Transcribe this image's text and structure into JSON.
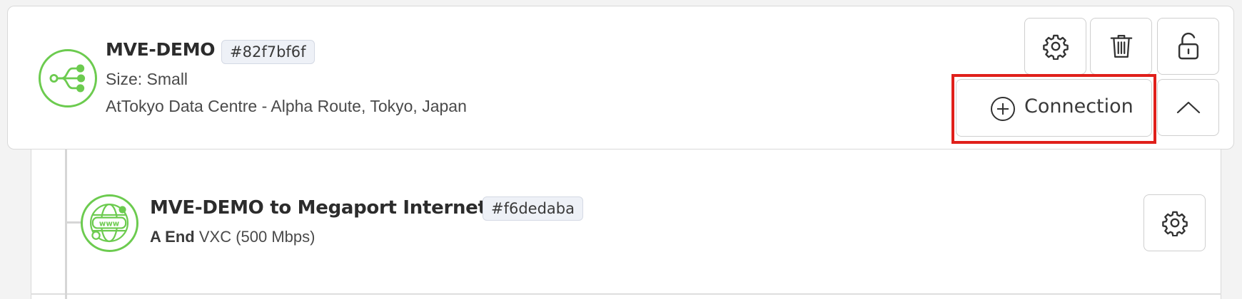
{
  "mve": {
    "name": "MVE-DEMO",
    "id_badge": "#82f7bf6f",
    "size_text": "Size: Small",
    "location_text": "AtTokyo Data Centre - Alpha Route, Tokyo, Japan",
    "icon": "mve-branch-icon",
    "accent_color": "#6ccb4f"
  },
  "actions": {
    "settings_icon": "gear-icon",
    "delete_icon": "trash-icon",
    "lock_icon": "unlocked-padlock-icon",
    "add_connection_label": "Connection",
    "add_connection_icon": "plus-circle-icon",
    "collapse_icon": "chevron-up-icon",
    "highlight_color": "#e0201b"
  },
  "connections": [
    {
      "name": "MVE-DEMO to Megaport Internet",
      "id_badge": "#f6dedaba",
      "end_label": "A End",
      "detail": "VXC (500 Mbps)",
      "icon": "www-globe-icon",
      "settings_icon": "gear-icon"
    }
  ]
}
